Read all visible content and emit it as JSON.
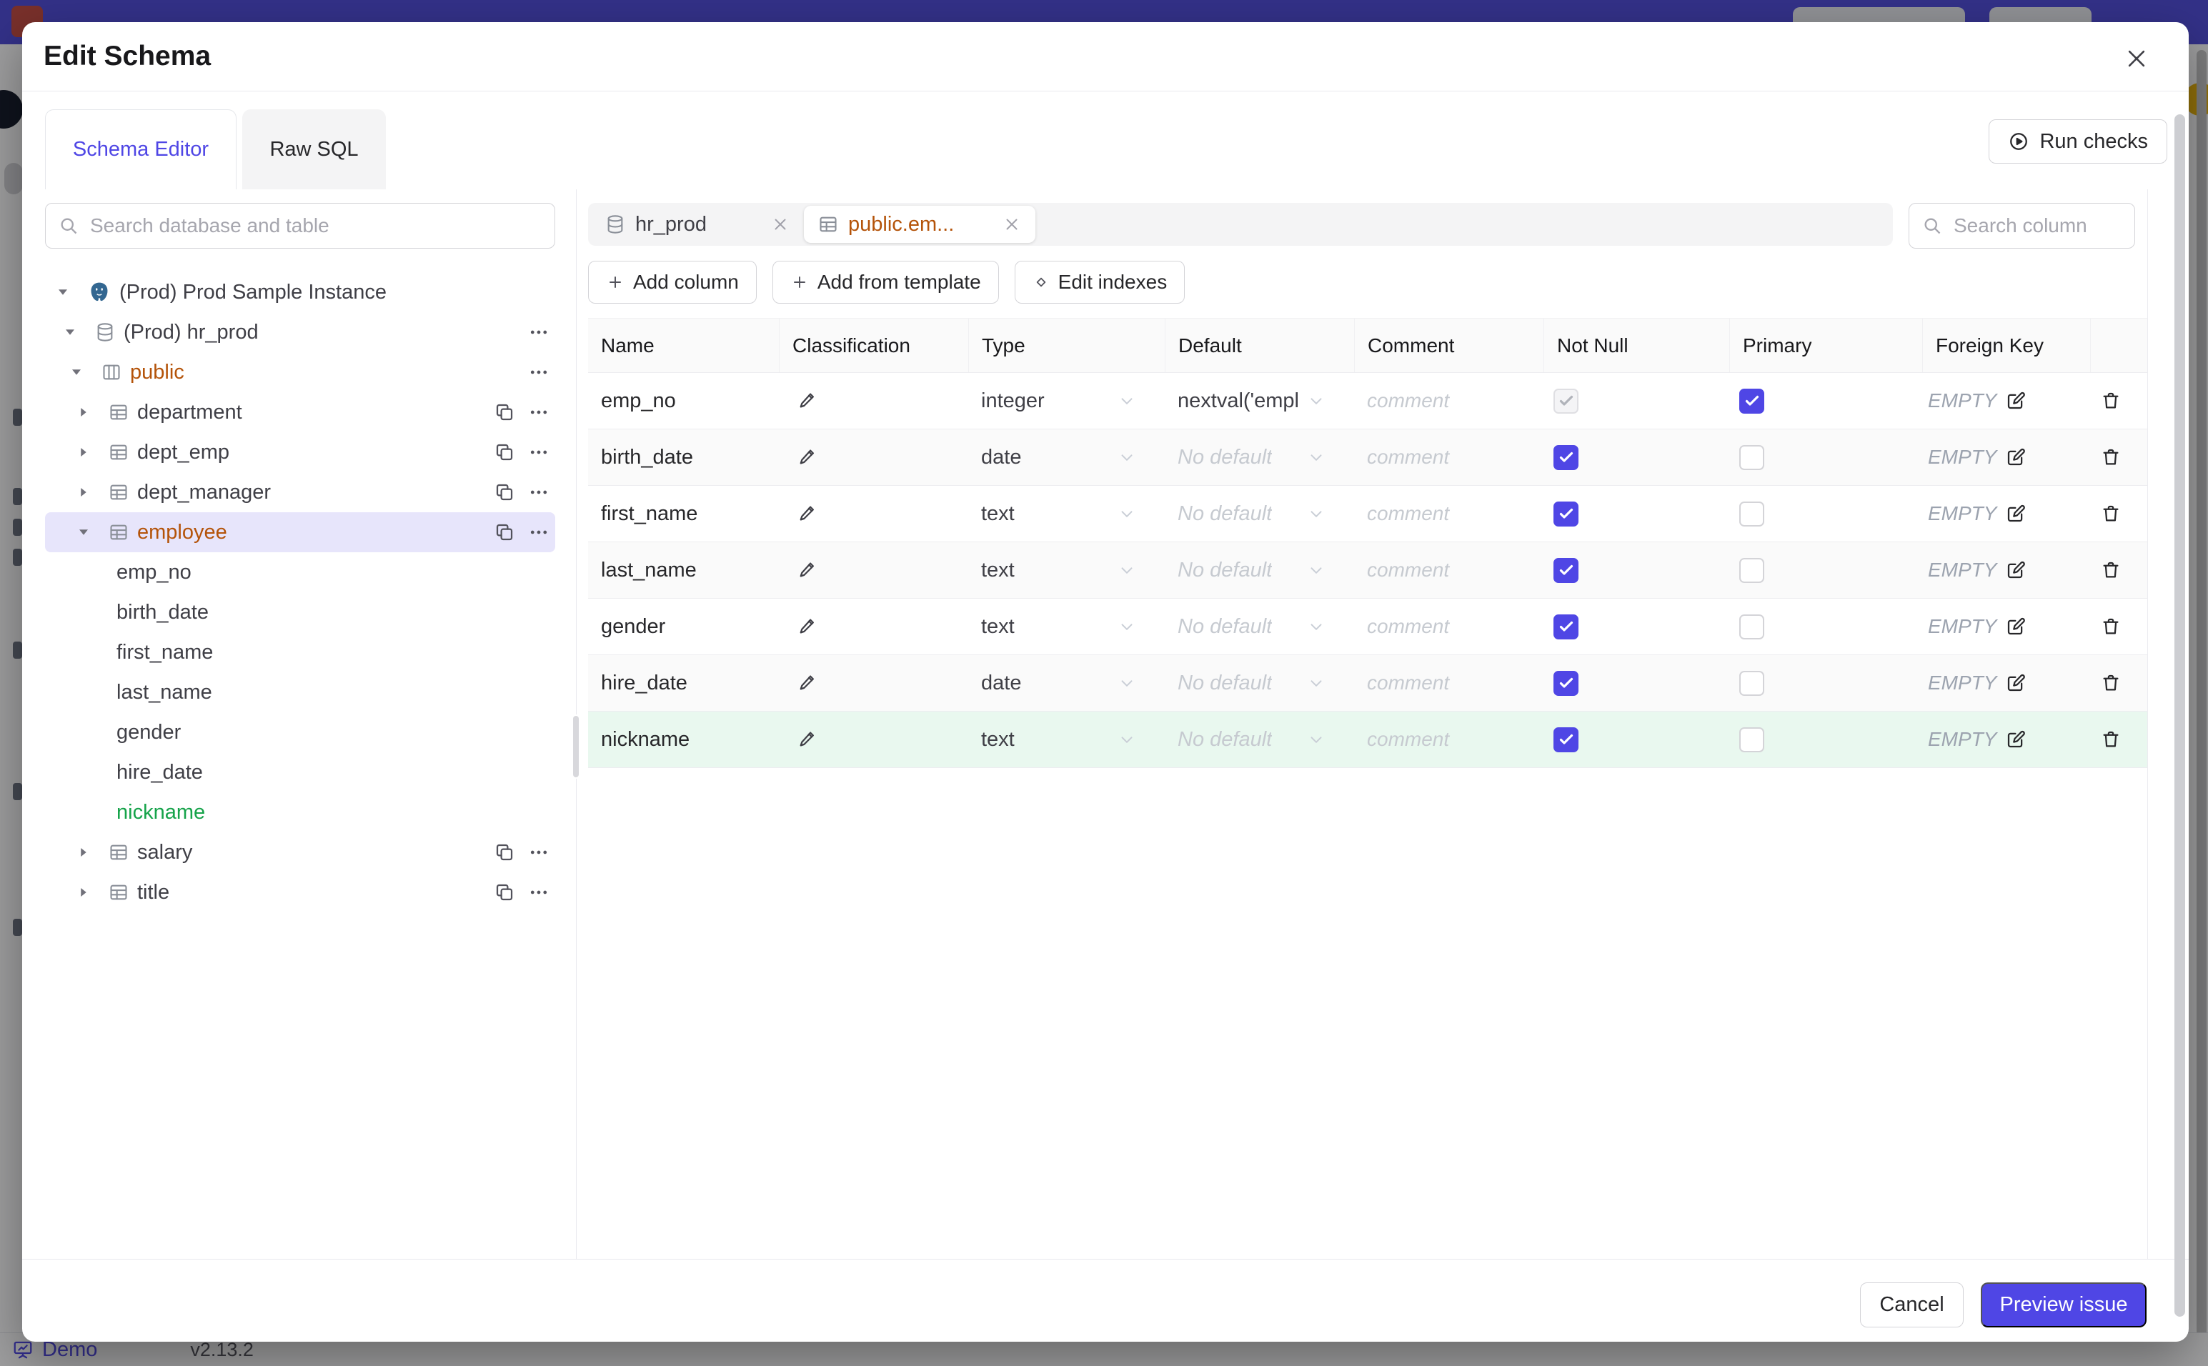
{
  "colors": {
    "accent": "#4f46e5",
    "schema_highlight": "#b45309",
    "new_item_green": "#16a34a",
    "new_row_bg": "#e9f8ef",
    "selected_tree_bg": "#e7e5fb",
    "topbar": "#4e4ad9"
  },
  "background": {
    "statusbar": {
      "demo": "Demo",
      "version": "v2.13.2"
    }
  },
  "modal": {
    "title": "Edit Schema",
    "header_tabs": [
      {
        "label": "Schema Editor",
        "active": true
      },
      {
        "label": "Raw SQL",
        "active": false
      }
    ],
    "run_checks": "Run checks",
    "sidebar": {
      "search_placeholder": "Search database and table",
      "tree": [
        {
          "label": "(Prod) Prod Sample Instance",
          "level": 0,
          "icon": "postgres",
          "caret": "down"
        },
        {
          "label": "(Prod) hr_prod",
          "level": 1,
          "icon": "database",
          "caret": "down",
          "menu": true
        },
        {
          "label": "public",
          "level": 2,
          "icon": "schema",
          "caret": "down",
          "menu": true,
          "highlight": "amber"
        },
        {
          "label": "department",
          "level": 3,
          "icon": "table",
          "caret": "right",
          "copy": true,
          "menu": true
        },
        {
          "label": "dept_emp",
          "level": 3,
          "icon": "table",
          "caret": "right",
          "copy": true,
          "menu": true
        },
        {
          "label": "dept_manager",
          "level": 3,
          "icon": "table",
          "caret": "right",
          "copy": true,
          "menu": true
        },
        {
          "label": "employee",
          "level": 3,
          "icon": "table",
          "caret": "down",
          "copy": true,
          "menu": true,
          "highlight": "amber",
          "selected": true
        },
        {
          "label": "emp_no",
          "level": 4
        },
        {
          "label": "birth_date",
          "level": 4
        },
        {
          "label": "first_name",
          "level": 4
        },
        {
          "label": "last_name",
          "level": 4
        },
        {
          "label": "gender",
          "level": 4
        },
        {
          "label": "hire_date",
          "level": 4
        },
        {
          "label": "nickname",
          "level": 4,
          "highlight": "green"
        },
        {
          "label": "salary",
          "level": 3,
          "icon": "table",
          "caret": "right",
          "copy": true,
          "menu": true
        },
        {
          "label": "title",
          "level": 3,
          "icon": "table",
          "caret": "right",
          "copy": true,
          "menu": true
        }
      ]
    },
    "editor": {
      "tabs": [
        {
          "label": "hr_prod",
          "icon": "database",
          "active": false
        },
        {
          "label": "public.em...",
          "icon": "table",
          "active": true
        }
      ],
      "toolbar": [
        {
          "label": "Add column",
          "icon": "plus"
        },
        {
          "label": "Add from template",
          "icon": "plus"
        },
        {
          "label": "Edit indexes",
          "icon": "diamond"
        }
      ],
      "search_placeholder": "Search column",
      "table": {
        "headers": [
          "Name",
          "Classification",
          "Type",
          "Default",
          "Comment",
          "Not Null",
          "Primary",
          "Foreign Key",
          ""
        ],
        "placeholders": {
          "default": "No default",
          "comment": "comment",
          "foreign_key": "EMPTY"
        },
        "rows": [
          {
            "name": "emp_no",
            "type": "integer",
            "default": "nextval('employ",
            "not_null": true,
            "not_null_disabled": true,
            "primary": true
          },
          {
            "name": "birth_date",
            "type": "date",
            "not_null": true,
            "primary": false
          },
          {
            "name": "first_name",
            "type": "text",
            "not_null": true,
            "primary": false
          },
          {
            "name": "last_name",
            "type": "text",
            "not_null": true,
            "primary": false
          },
          {
            "name": "gender",
            "type": "text",
            "not_null": true,
            "primary": false
          },
          {
            "name": "hire_date",
            "type": "date",
            "not_null": true,
            "primary": false
          },
          {
            "name": "nickname",
            "type": "text",
            "not_null": true,
            "primary": false,
            "state": "new"
          }
        ]
      }
    },
    "footer": {
      "cancel": "Cancel",
      "submit": "Preview issue"
    }
  }
}
